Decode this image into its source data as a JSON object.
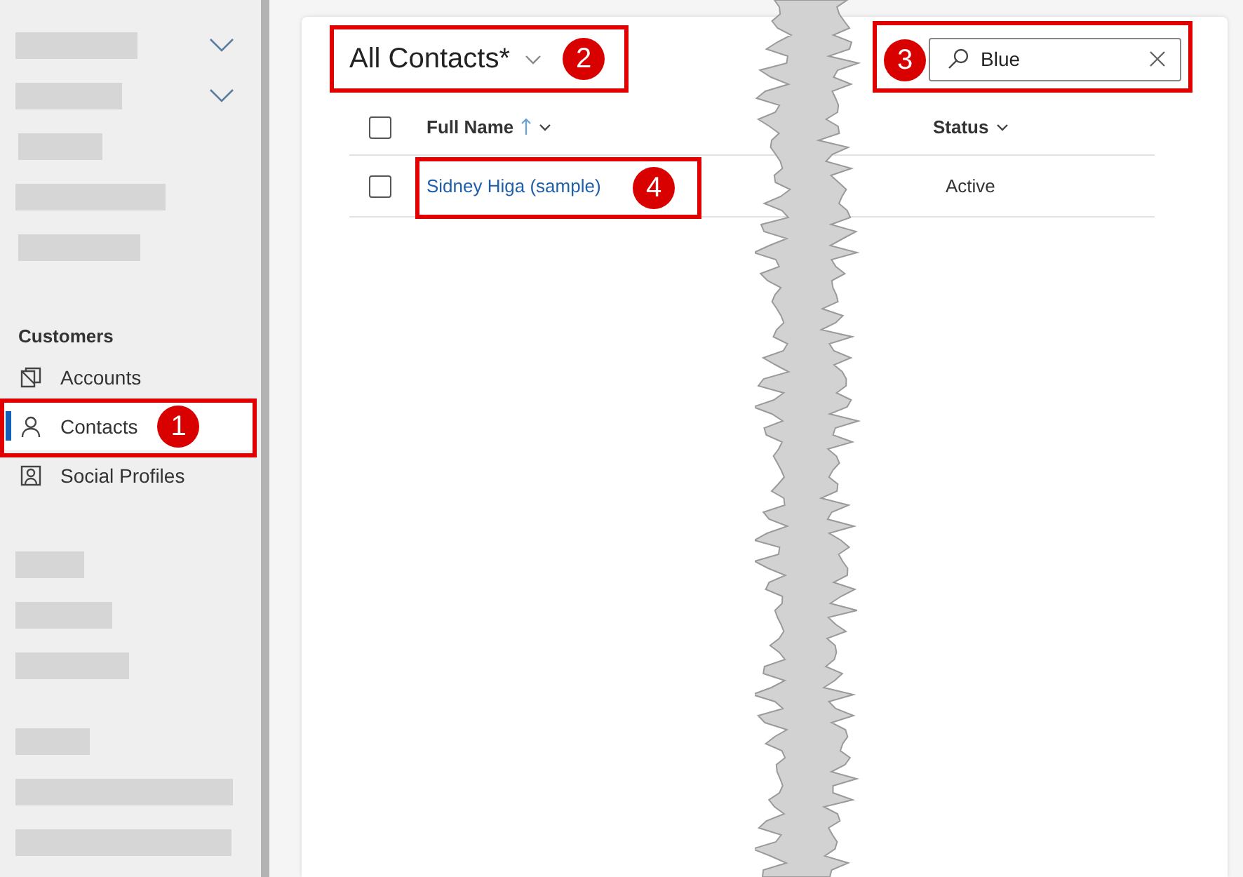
{
  "sidebar": {
    "top_items": [
      {
        "kind": "group",
        "expanded": false
      },
      {
        "kind": "group",
        "expanded": false
      },
      {
        "kind": "link"
      },
      {
        "kind": "link"
      },
      {
        "kind": "link"
      }
    ],
    "section_title": "Customers",
    "items": [
      {
        "label": "Accounts",
        "kind": "account",
        "selected": false
      },
      {
        "label": "Contacts",
        "kind": "person",
        "selected": true
      },
      {
        "label": "Social Profiles",
        "kind": "profile",
        "selected": false
      }
    ],
    "bottom_items": [
      {
        "kind": "link"
      },
      {
        "kind": "link"
      },
      {
        "kind": "link"
      },
      {
        "kind": "link"
      },
      {
        "kind": "link"
      },
      {
        "kind": "link"
      }
    ]
  },
  "view": {
    "title": "All Contacts*",
    "search": {
      "value": "Blue"
    },
    "select_all": {
      "checked": false
    },
    "columns": [
      {
        "label": "Full Name",
        "sorted": true
      },
      {
        "label": "Status",
        "sorted": false
      }
    ],
    "rows": [
      {
        "checked": false,
        "full_name": "Sidney Higa (sample)",
        "status": "Active"
      }
    ]
  },
  "callouts": [
    {
      "number": "1"
    },
    {
      "number": "2"
    },
    {
      "number": "3"
    },
    {
      "number": "4"
    }
  ]
}
